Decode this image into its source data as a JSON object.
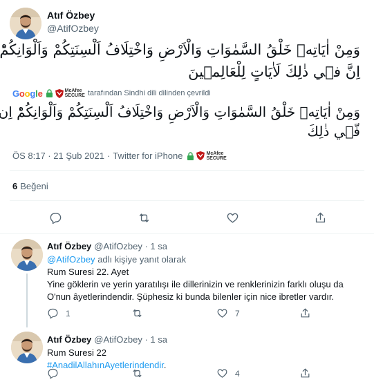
{
  "main_tweet": {
    "author_name": "Atıf Özbey",
    "author_handle": "@AtifOzbey",
    "arabic_line1": "وَمِنْ اٰيَاتِه۪ خَلْقُ السَّمٰوَاتِ وَالْاَرْضِ وَاخْتِلَافُ اَلْسِنَتِكُمْ وَاَلْوَانِكُمْؕ",
    "arabic_line2": "اِنَّ ف۪ي ذٰلِكَ لَاٰيَاتٍ لِلْعَالِم۪ينَ",
    "translation_bar": {
      "google": "Google",
      "mcafee_line1": "McAfee",
      "mcafee_line2": "SECURE",
      "translated_by": "tarafından Sindhi dili dilinden çevrildi"
    },
    "translated_line1": "وَمِنْ اٰيَاتِه۪ خَلْقُ السَّمٰوَاتِ وَالْاَرْضِ وَاخْتِلَافُ اَلْسِنَتِكُمْ وَاَلْوَانِكُمْؕ اِن",
    "translated_line2": "فّ۪ي ذٰلِكَ",
    "timestamp": "ÖS 8:17 · 21 Şub 2021",
    "separator": "·",
    "source": "Twitter for iPhone",
    "like_count": "6",
    "like_label": "Beğeni"
  },
  "replies": [
    {
      "author_name": "Atıf Özbey",
      "author_handle": "@AtifOzbey · 1 sa",
      "replying_to_handle": "@AtifOzbey",
      "replying_to_suffix": "adlı kişiye yanıt olarak",
      "text_line1": "Rum Suresi 22. Ayet",
      "text_line2": "Yine göklerin ve yerin yaratılışı ile dillerinizin ve renklerinizin farklı oluşu da",
      "text_line3": "O'nun âyetlerindendir. Şüphesiz ki bunda bilenler için nice ibretler vardır.",
      "reply_count": "1",
      "retweet_count": "",
      "like_count": "7"
    },
    {
      "author_name": "Atıf Özbey",
      "author_handle": "@AtifOzbey · 1 sa",
      "text_line1": "Rum Suresi 22",
      "hashtag": "#AnadilAllahınAyetlerindendir",
      "hashtag_suffix": ".",
      "reply_count": "",
      "retweet_count": "",
      "like_count": "4"
    }
  ],
  "icons": {
    "reply": "reply-icon",
    "retweet": "retweet-icon",
    "like": "heart-icon",
    "share": "share-icon",
    "lock": "lock-icon",
    "mcafee": "mcafee-shield-icon"
  },
  "colors": {
    "link": "#1d9bf0",
    "secondary_text": "#536471",
    "primary_text": "#0f1419",
    "divider": "#eff3f4"
  }
}
